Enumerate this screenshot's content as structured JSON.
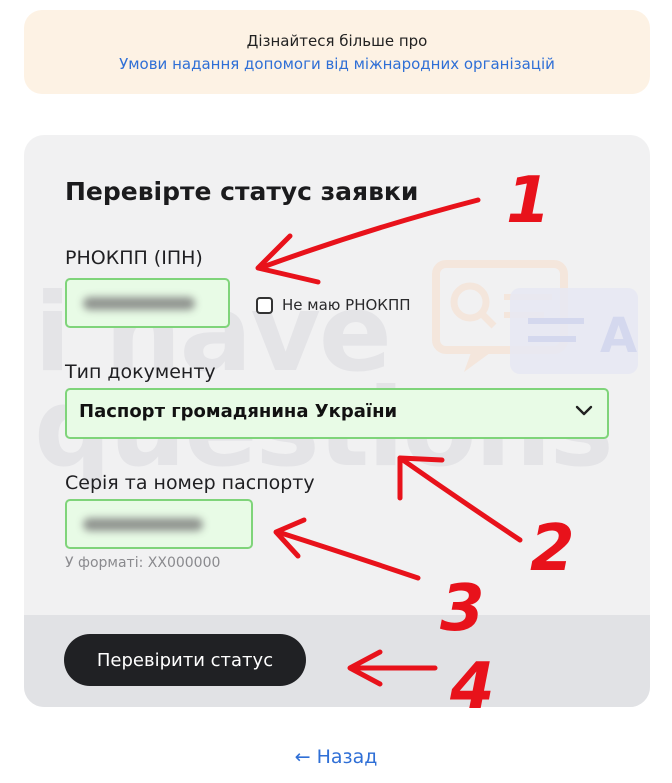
{
  "info_banner": {
    "line1": "Дізнайтеся більше про",
    "link": "Умови надання допомоги від міжнародних організацій"
  },
  "form": {
    "title": "Перевірте статус заявки",
    "rnokpp_label": "РНОКПП (ІПН)",
    "no_rnokpp_label": "Не маю РНОКПП",
    "doc_type_label": "Тип документу",
    "doc_type_value": "Паспорт громадянина України",
    "passport_label": "Серія та номер паспорту",
    "passport_hint": "У форматі: ХХ000000",
    "submit_label": "Перевірити статус"
  },
  "back_link": "← Назад",
  "watermark": {
    "line1": "i have",
    "line2": "questions"
  },
  "annotations": [
    "1",
    "2",
    "3",
    "4"
  ],
  "colors": {
    "accent_link": "#2f6fd6",
    "banner_bg": "#fdf2e4",
    "field_bg": "#e8fbe6",
    "field_border": "#7fd47a",
    "button_bg": "#202124",
    "annotation": "#e8121b"
  }
}
